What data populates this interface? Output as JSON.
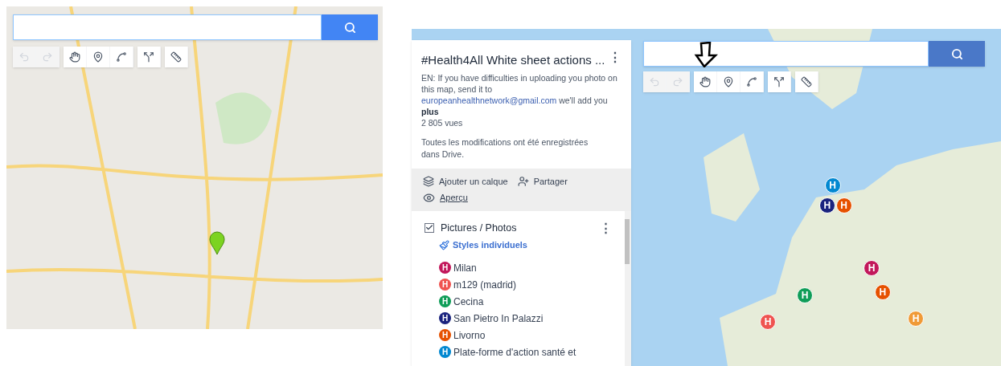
{
  "left_map": {
    "tools": [
      {
        "kind": "undo",
        "disabled": true
      },
      {
        "kind": "redo",
        "disabled": true
      },
      {
        "kind": "hand",
        "disabled": false
      },
      {
        "kind": "marker",
        "disabled": false
      },
      {
        "kind": "line",
        "disabled": false
      },
      {
        "kind": "route",
        "disabled": false
      },
      {
        "kind": "ruler",
        "disabled": false
      }
    ],
    "markers": [
      {
        "kind": "pin",
        "color": "#7cd321"
      }
    ]
  },
  "right_map": {
    "panel": {
      "title": "#Health4All White sheet actions ...",
      "menu": "⋮",
      "description": "EN: If you have difficulties in uploading you photo on this map, send it to",
      "email": "europeanhealthnetwork@gmail.com",
      "description_end": "we'll add you",
      "more": "plus",
      "views": "2 805 vues",
      "saved": "Toutes les modifications ont été enregistrées dans Drive.",
      "actions": [
        {
          "kind": "layers",
          "label": "Ajouter un calque"
        },
        {
          "kind": "share",
          "label": "Partager"
        },
        {
          "kind": "preview",
          "label": "Aperçu"
        }
      ],
      "layer": {
        "name": "Pictures / Photos",
        "checked": true,
        "menu": "⋮",
        "style": "Styles individuels",
        "items": [
          {
            "badge": "H",
            "label": "Milan",
            "color": "#c2185b"
          },
          {
            "badge": "H",
            "label": "m129 (madrid)",
            "color": "#ef5350"
          },
          {
            "badge": "H",
            "label": "Cecina",
            "color": "#0f9d58"
          },
          {
            "badge": "H",
            "label": "San Pietro In Palazzi",
            "color": "#1a237e"
          },
          {
            "badge": "H",
            "label": "Livorno",
            "color": "#e65100"
          },
          {
            "badge": "H",
            "label": "Plate-forme d'action santé et",
            "color": "#0288d1"
          }
        ]
      }
    },
    "tools": [
      {
        "kind": "undo",
        "disabled": true
      },
      {
        "kind": "redo",
        "disabled": true
      },
      {
        "kind": "hand",
        "disabled": false
      },
      {
        "kind": "marker",
        "disabled": false
      },
      {
        "kind": "line",
        "disabled": false
      },
      {
        "kind": "route",
        "disabled": false
      },
      {
        "kind": "ruler",
        "disabled": false
      }
    ],
    "markers": [
      {
        "badge": "H",
        "color": "#0288d1"
      },
      {
        "badge": "H",
        "color": "#1a237e"
      },
      {
        "badge": "H",
        "color": "#e65100"
      },
      {
        "badge": "H",
        "color": "#c2185b"
      },
      {
        "badge": "H",
        "color": "#e65100"
      },
      {
        "badge": "H",
        "color": "#0f9d58"
      },
      {
        "badge": "H",
        "color": "#ef5350"
      },
      {
        "badge": "H",
        "color": "#f09a37"
      }
    ]
  }
}
